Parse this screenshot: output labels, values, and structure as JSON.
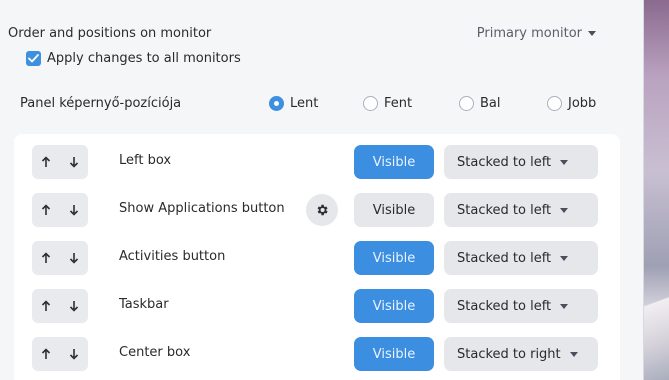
{
  "section": {
    "title": "Order and positions on monitor",
    "monitor_select": "Primary monitor"
  },
  "apply_all": {
    "label": "Apply changes to all monitors",
    "checked": true
  },
  "panel_position": {
    "label": "Panel képernyő-pozíciója",
    "options": [
      {
        "label": "Lent",
        "selected": true
      },
      {
        "label": "Fent",
        "selected": false
      },
      {
        "label": "Bal",
        "selected": false
      },
      {
        "label": "Jobb",
        "selected": false
      }
    ]
  },
  "items": [
    {
      "label": "Left box",
      "visible_label": "Visible",
      "visible_on": true,
      "position": "Stacked to left",
      "has_settings": false
    },
    {
      "label": "Show Applications button",
      "visible_label": "Visible",
      "visible_on": false,
      "position": "Stacked to left",
      "has_settings": true
    },
    {
      "label": "Activities button",
      "visible_label": "Visible",
      "visible_on": true,
      "position": "Stacked to left",
      "has_settings": false
    },
    {
      "label": "Taskbar",
      "visible_label": "Visible",
      "visible_on": true,
      "position": "Stacked to left",
      "has_settings": false
    },
    {
      "label": "Center box",
      "visible_label": "Visible",
      "visible_on": true,
      "position": "Stacked to right",
      "has_settings": false
    }
  ],
  "icons": {
    "up": "arrow-up-icon",
    "down": "arrow-down-icon",
    "gear": "gear-icon",
    "caret": "chevron-down-icon"
  },
  "colors": {
    "accent": "#3b8ee0",
    "panel_bg": "#f5f6f8",
    "button_bg": "#e6e7eb"
  }
}
